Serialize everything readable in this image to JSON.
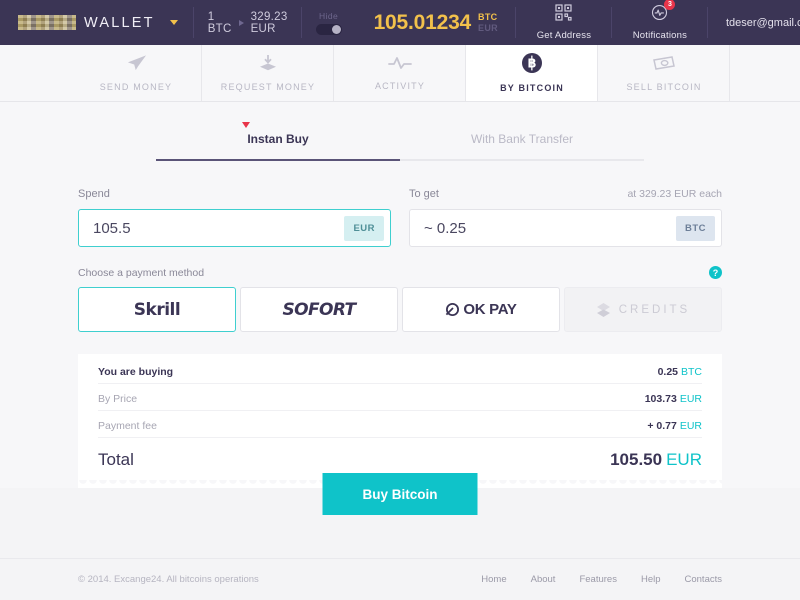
{
  "topbar": {
    "logo_text": "WALLET",
    "logo_mark": "blurred-logo-mark",
    "rate": {
      "from": "1 BTC",
      "to": "329.23 EUR"
    },
    "hide_label": "Hide",
    "balance": {
      "amount": "105.01234",
      "unit_primary": "BTC",
      "unit_secondary": "EUR"
    },
    "get_address": {
      "label": "Get Address",
      "icon": "qr-code-icon"
    },
    "notifications": {
      "label": "Notifications",
      "icon": "activity-bell-icon",
      "badge": "3"
    },
    "user": {
      "email": "tdeser@gmail.com"
    }
  },
  "nav": {
    "tabs": [
      {
        "label": "SEND MONEY",
        "icon": "paper-plane-icon",
        "active": false
      },
      {
        "label": "REQUEST MONEY",
        "icon": "download-tray-icon",
        "active": false
      },
      {
        "label": "ACTIVITY",
        "icon": "pulse-line-icon",
        "active": false
      },
      {
        "label": "BY BITCOIN",
        "icon": "bitcoin-circle-icon",
        "active": true
      },
      {
        "label": "SELL BITCOIN",
        "icon": "banknote-icon",
        "active": false
      }
    ]
  },
  "subtabs": [
    {
      "label": "Instan Buy",
      "active": true
    },
    {
      "label": "With Bank Transfer",
      "active": false
    }
  ],
  "form": {
    "spend": {
      "label": "Spend",
      "value": "105.5",
      "placeholder": "0.00",
      "unit": "EUR",
      "focused": true
    },
    "toget": {
      "label": "To get",
      "note": "at 329.23 EUR each",
      "value": "~ 0.25",
      "placeholder": "0.00",
      "unit": "BTC",
      "focused": false
    },
    "payment": {
      "label": "Choose a payment method",
      "help_icon": "question-mark-icon",
      "methods": [
        {
          "name": "Skrill",
          "state": "selected"
        },
        {
          "name": "SOFORT",
          "state": "default"
        },
        {
          "name": "OK PAY",
          "state": "default"
        },
        {
          "name": "CREDITS",
          "state": "disabled"
        }
      ]
    }
  },
  "summary": {
    "lines": [
      {
        "name": "You are buying",
        "value": "0.25",
        "currency": "BTC"
      },
      {
        "name": "By Price",
        "value": "103.73",
        "currency": "EUR"
      },
      {
        "name": "Payment fee",
        "value": "+ 0.77",
        "currency": "EUR"
      }
    ],
    "total": {
      "name": "Total",
      "value": "105.50",
      "currency": "EUR"
    },
    "cta": "Buy Bitcoin"
  },
  "footer": {
    "copyright": "© 2014. Excange24. All bitcoins operations",
    "links": [
      "Home",
      "About",
      "Features",
      "Help",
      "Contacts"
    ]
  },
  "colors": {
    "header_bg": "#3b3555",
    "accent_teal": "#0fc3c9",
    "accent_yellow": "#f2c14b",
    "badge_red": "#e8344a",
    "page_bg": "#f7f7f9"
  }
}
